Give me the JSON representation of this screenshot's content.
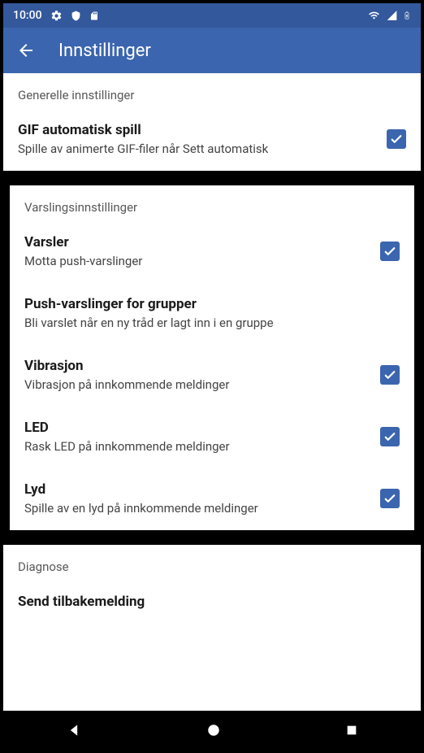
{
  "status": {
    "time": "10:00"
  },
  "appbar": {
    "title": "Innstillinger"
  },
  "sections": {
    "general": {
      "header": "Generelle innstillinger",
      "gif": {
        "title": "GIF automatisk spill",
        "subtitle": "Spille av animerte GIF-filer når Sett automatisk"
      }
    },
    "notifications": {
      "header": "Varslingsinnstillinger",
      "varsler": {
        "title": "Varsler",
        "subtitle": "Motta push-varslinger"
      },
      "grupper": {
        "title": "Push-varslinger for grupper",
        "subtitle": "Bli varslet når en ny tråd er lagt inn i en gruppe"
      },
      "vibrasjon": {
        "title": "Vibrasjon",
        "subtitle": "Vibrasjon på innkommende meldinger"
      },
      "led": {
        "title": "LED",
        "subtitle": "Rask LED på innkommende meldinger"
      },
      "lyd": {
        "title": "Lyd",
        "subtitle": "Spille av en lyd på innkommende meldinger"
      }
    },
    "diagnose": {
      "header": "Diagnose",
      "feedback": {
        "title": "Send tilbakemelding"
      }
    }
  }
}
